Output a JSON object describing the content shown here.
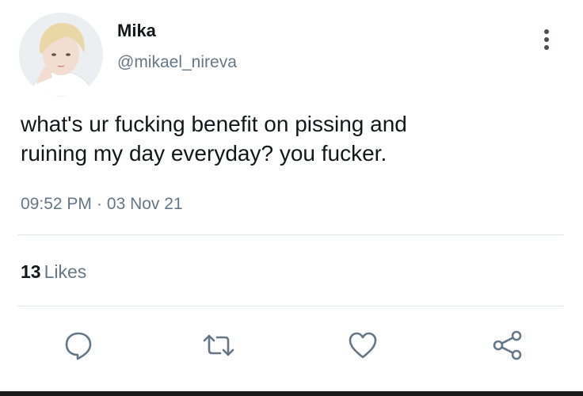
{
  "user": {
    "display_name": "Mika",
    "handle": "@mikael_nireva",
    "avatar_icon": "profile-photo"
  },
  "tweet": {
    "text": "what's ur fucking benefit on pissing and\nruining my day everyday? you fucker.",
    "time": "09:52 PM",
    "separator": "·",
    "date": "03 Nov 21"
  },
  "stats": {
    "likes_count": "13",
    "likes_label": "Likes"
  },
  "actions": [
    {
      "name": "reply",
      "icon": "speech-bubble-icon"
    },
    {
      "name": "retweet",
      "icon": "retweet-arrows-icon"
    },
    {
      "name": "like",
      "icon": "heart-icon"
    },
    {
      "name": "share",
      "icon": "share-nodes-icon"
    }
  ],
  "colors": {
    "text_primary": "#14171a",
    "text_secondary": "#657786",
    "divider": "#e1e8ed",
    "icon": "#657786"
  }
}
